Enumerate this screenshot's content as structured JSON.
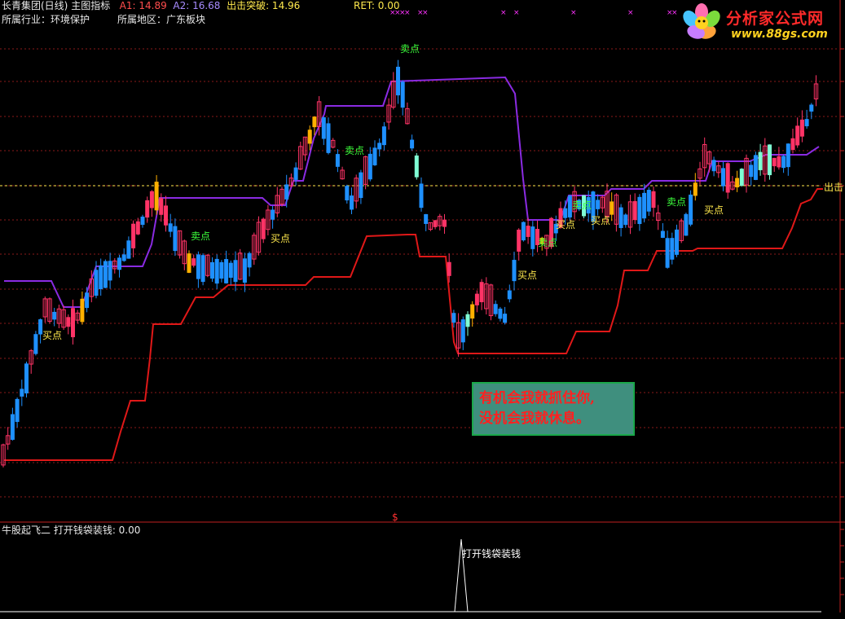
{
  "header": {
    "stock_name": "长青集团(日线)",
    "indicator_name": "主图指标",
    "a1_label": "A1: 14.89",
    "a2_label": "A2: 16.68",
    "breakout_label": "出击突破: 14.96",
    "ret_label": "RET: 0.00",
    "industry_label": "所属行业：环境保护",
    "region_label": "所属地区：广东板块"
  },
  "logo": {
    "title": "分析家公式网",
    "url": "www.88gs.com"
  },
  "colors": {
    "up": "#ff3366",
    "down": "#1e90ff",
    "upper_line": "#8a2be2",
    "lower_line": "#e01818",
    "grid": "#8b1a1a",
    "dashed": "#ffe94d",
    "sell": "#3cff3c",
    "buy": "#ffe94d"
  },
  "signals": {
    "sell_label": "卖点",
    "buy_label": "买点",
    "exit_label": "出击"
  },
  "quote": {
    "line1": "有机会我就抓住你,",
    "line2": "没机会我就休息。"
  },
  "sub_panel": {
    "title": "牛股起飞二  打开钱袋装钱: 0.00",
    "spike_label": "打开钱袋装钱"
  },
  "marker": {
    "dollar": "$"
  }
}
